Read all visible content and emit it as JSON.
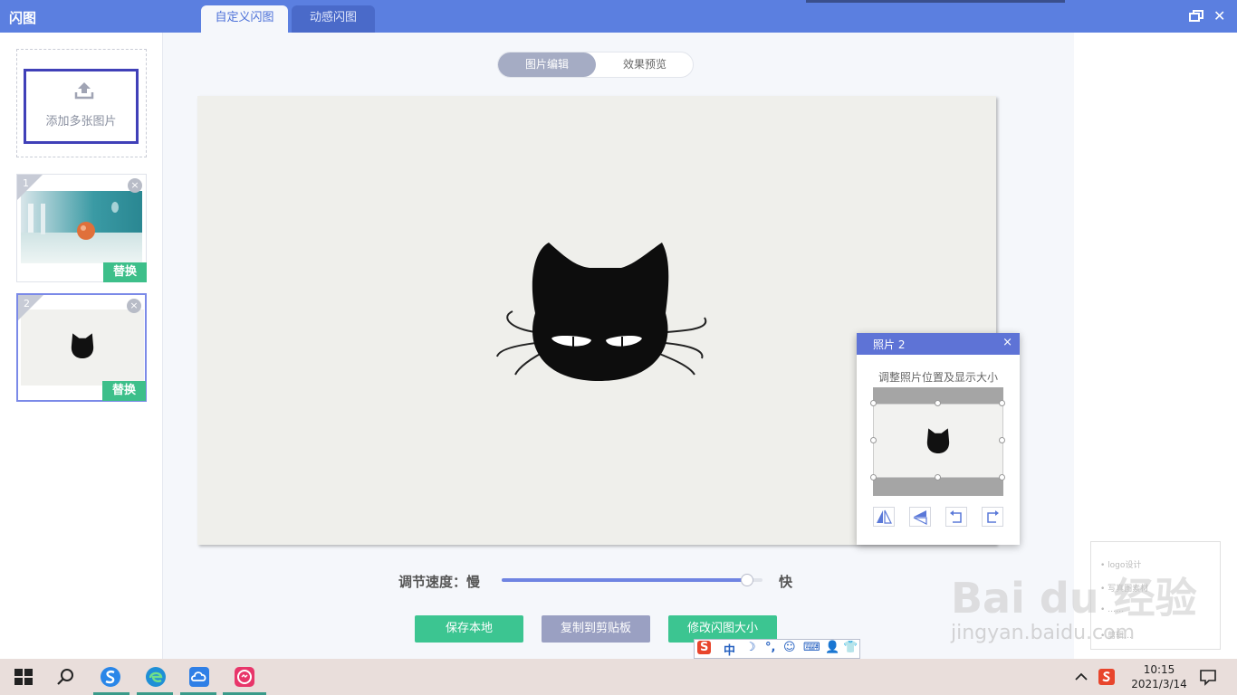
{
  "app": {
    "title": "闪图",
    "tabs": [
      {
        "label": "自定义闪图",
        "active": true
      },
      {
        "label": "动感闪图",
        "active": false
      }
    ]
  },
  "sidebar": {
    "add_label": "添加多张图片",
    "items": [
      {
        "number": "1",
        "replace_label": "替换",
        "close": "×"
      },
      {
        "number": "2",
        "replace_label": "替换",
        "close": "×"
      }
    ]
  },
  "view_toggle": {
    "edit_label": "图片编辑",
    "preview_label": "效果预览",
    "active": "edit"
  },
  "speed": {
    "label": "调节速度：慢",
    "fast_label": "快",
    "value_fraction": 0.94
  },
  "actions": {
    "save_label": "保存本地",
    "copy_label": "复制到剪贴板",
    "resize_label": "修改闪图大小"
  },
  "photo_panel": {
    "title": "照片 2",
    "close": "×",
    "hint": "调整照片位置及显示大小",
    "tools": [
      "flip-horizontal-icon",
      "flip-vertical-icon",
      "rotate-left-icon",
      "rotate-right-icon"
    ]
  },
  "ime": {
    "items": [
      "S",
      "中",
      "☽",
      "°,",
      "☺",
      "⌨",
      "👤",
      "👕"
    ]
  },
  "taskbar": {
    "time": "10:15",
    "date": "2021/3/14"
  },
  "watermark": {
    "text": "Bai du 经验",
    "sub": "jingyan.baidu.com"
  },
  "colors": {
    "titlebar": "#5b7fe0",
    "accent_green": "#3cc591",
    "accent_grey_button": "#9aa0c2",
    "slider_fill": "#6f84e2"
  }
}
